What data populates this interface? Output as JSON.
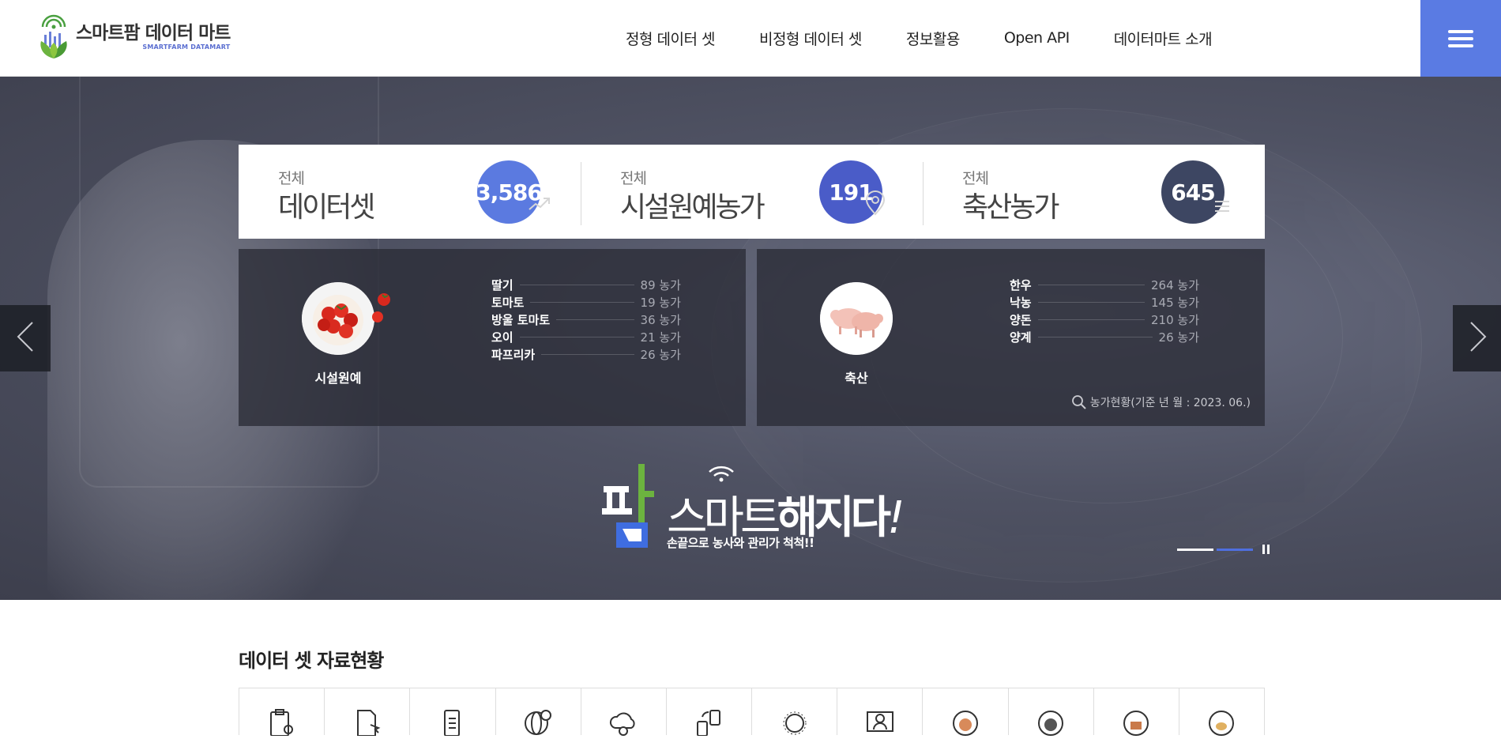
{
  "header": {
    "logo_title": "스마트팜 데이터 마트",
    "logo_sub": "SMARTFARM DATAMART",
    "nav": [
      "정형 데이터 셋",
      "비정형 데이터 셋",
      "정보활용",
      "Open API",
      "데이터마트 소개"
    ],
    "menu_icon": "hamburger-menu-icon",
    "accent": "#5a7be3"
  },
  "stats": [
    {
      "small": "전체",
      "label": "데이터셋",
      "value": "3,586",
      "color": "#5b7ae0",
      "icon": "trend-icon"
    },
    {
      "small": "전체",
      "label": "시설원예농가",
      "value": "191",
      "color": "#4a5cc8",
      "icon": "location-pin-icon"
    },
    {
      "small": "전체",
      "label": "축산농가",
      "value": "645",
      "color": "#3d4662",
      "icon": "list-icon"
    }
  ],
  "facility": {
    "label": "시설원예",
    "rows": [
      {
        "name": "딸기",
        "value": "89 농가"
      },
      {
        "name": "토마토",
        "value": "19 농가"
      },
      {
        "name": "방울 토마토",
        "value": "36 농가"
      },
      {
        "name": "오이",
        "value": "21 농가"
      },
      {
        "name": "파프리카",
        "value": "26 농가"
      }
    ]
  },
  "livestock": {
    "label": "축산",
    "rows": [
      {
        "name": "한우",
        "value": "264 농가"
      },
      {
        "name": "낙농",
        "value": "145 농가"
      },
      {
        "name": "양돈",
        "value": "210 농가"
      },
      {
        "name": "양계",
        "value": "26 농가"
      }
    ],
    "note": "농가현황(기준 년 월 : 2023. 06.)"
  },
  "slogan": {
    "brand_char": "팜",
    "main_light": "스마트",
    "main_bold": "해지다",
    "exclaim": "!",
    "sub": "손끝으로 농사와 관리가 척척!!"
  },
  "slider": {
    "active_color": "#4f6fe0",
    "inactive_color": "#ffffff"
  },
  "section": {
    "title": "데이터 셋 자료현황",
    "icons": [
      "clipboard-search-icon",
      "document-cursor-icon",
      "document-list-icon",
      "globe-user-icon",
      "cloud-gear-icon",
      "devices-sync-icon",
      "sun-icon",
      "screen-user-icon",
      "cycle-cow-icon",
      "cycle-livestock-icon",
      "cycle-barn-icon",
      "cycle-chicken-icon"
    ]
  }
}
